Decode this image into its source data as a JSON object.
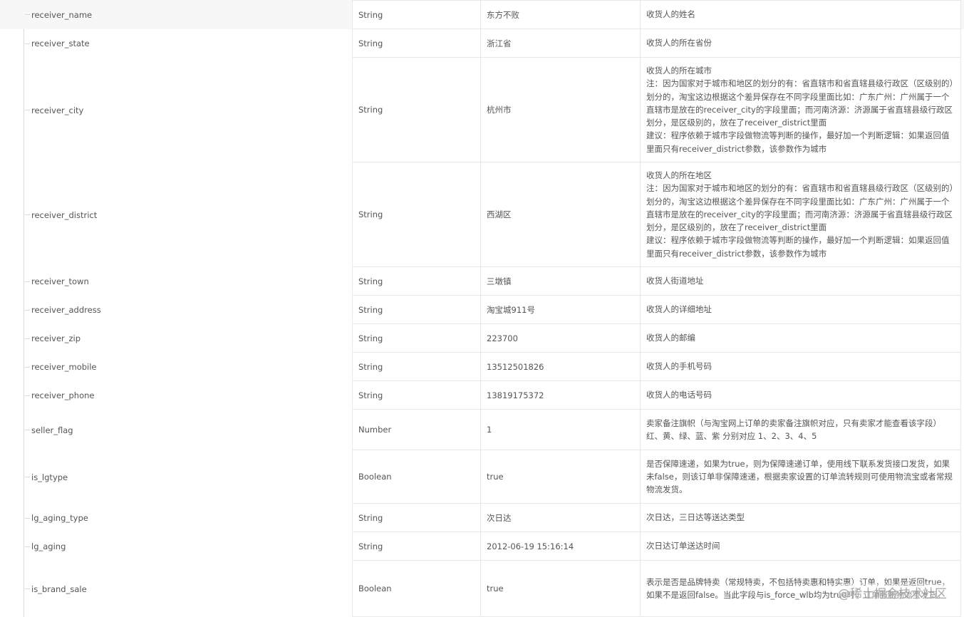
{
  "rows": [
    {
      "name": "receiver_name",
      "type": "String",
      "example": "东方不败",
      "desc": "收货人的姓名"
    },
    {
      "name": "receiver_state",
      "type": "String",
      "example": "浙江省",
      "desc": "收货人的所在省份"
    },
    {
      "name": "receiver_city",
      "type": "String",
      "example": "杭州市",
      "desc": "收货人的所在城市\n注：因为国家对于城市和地区的划分的有：省直辖市和省直辖县级行政区（区级别的）划分的，淘宝这边根据这个差异保存在不同字段里面比如：广东广州：广州属于一个直辖市是放在的receiver_city的字段里面；而河南济源：济源属于省直辖县级行政区划分，是区级别的，放在了receiver_district里面\n建议：程序依赖于城市字段做物流等判断的操作，最好加一个判断逻辑：如果返回值里面只有receiver_district参数，该参数作为城市"
    },
    {
      "name": "receiver_district",
      "type": "String",
      "example": "西湖区",
      "desc": "收货人的所在地区\n注：因为国家对于城市和地区的划分的有：省直辖市和省直辖县级行政区（区级别的）划分的，淘宝这边根据这个差异保存在不同字段里面比如：广东广州：广州属于一个直辖市是放在的receiver_city的字段里面；而河南济源：济源属于省直辖县级行政区划分，是区级别的，放在了receiver_district里面\n建议：程序依赖于城市字段做物流等判断的操作，最好加一个判断逻辑：如果返回值里面只有receiver_district参数，该参数作为城市"
    },
    {
      "name": "receiver_town",
      "type": "String",
      "example": "三墩镇",
      "desc": "收货人街道地址"
    },
    {
      "name": "receiver_address",
      "type": "String",
      "example": "淘宝城911号",
      "desc": "收货人的详细地址"
    },
    {
      "name": "receiver_zip",
      "type": "String",
      "example": "223700",
      "desc": "收货人的邮编"
    },
    {
      "name": "receiver_mobile",
      "type": "String",
      "example": "13512501826",
      "desc": "收货人的手机号码"
    },
    {
      "name": "receiver_phone",
      "type": "String",
      "example": "13819175372",
      "desc": "收货人的电话号码"
    },
    {
      "name": "seller_flag",
      "type": "Number",
      "example": "1",
      "desc": "卖家备注旗帜（与淘宝网上订单的卖家备注旗帜对应，只有卖家才能查看该字段）红、黄、绿、蓝、紫 分别对应 1、2、3、4、5"
    },
    {
      "name": "is_lgtype",
      "type": "Boolean",
      "example": "true",
      "desc": "是否保障速递，如果为true，则为保障速递订单，使用线下联系发货接口发货，如果未false，则该订单非保障速递，根据卖家设置的订单流转规则可使用物流宝或者常规物流发货。"
    },
    {
      "name": "lg_aging_type",
      "type": "String",
      "example": "次日达",
      "desc": "次日达，三日达等送达类型"
    },
    {
      "name": "lg_aging",
      "type": "String",
      "example": "2012-06-19 15:16:14",
      "desc": "次日达订单送达时间"
    },
    {
      "name": "is_brand_sale",
      "type": "Boolean",
      "example": "true",
      "desc": "表示是否是品牌特卖（常规特卖，不包括特卖惠和特实惠）订单，如果是返回true，如果不是返回false。当此字段与is_force_wlb均为true时，订单强制物流宝发货。"
    }
  ],
  "watermark": "@稀土掘金技术社区"
}
